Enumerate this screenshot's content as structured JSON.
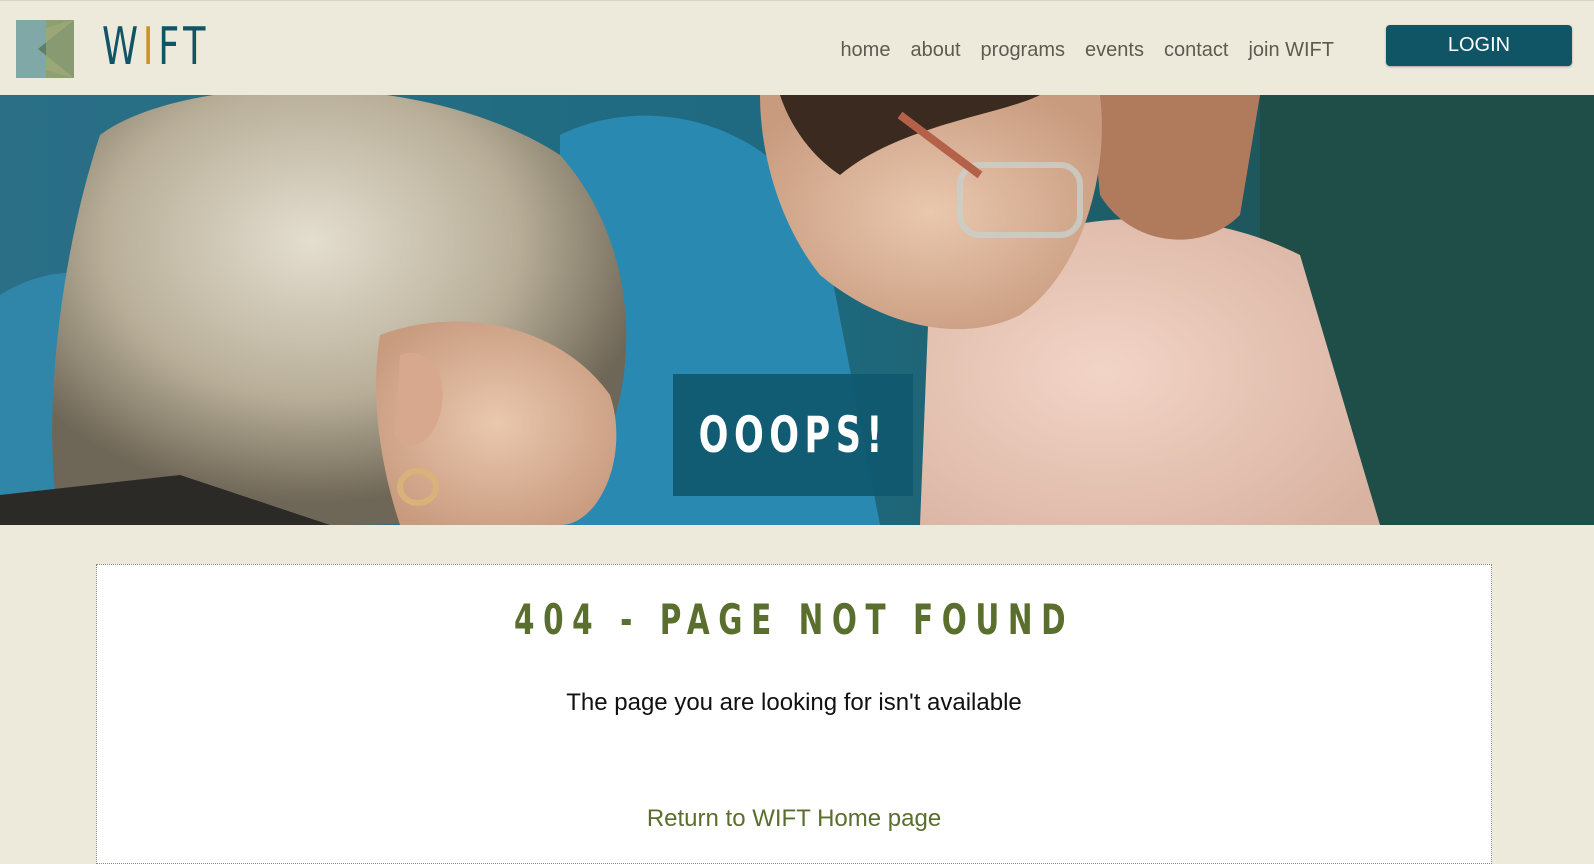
{
  "brand": {
    "logo_text_1": "W",
    "logo_text_accent": "I",
    "logo_text_2": "FT",
    "colors": {
      "teal": "#0f5566",
      "gold": "#c9951e",
      "olive": "#5a6f2e",
      "background": "#eeeadb"
    }
  },
  "nav": {
    "items": [
      {
        "label": "home"
      },
      {
        "label": "about"
      },
      {
        "label": "programs"
      },
      {
        "label": "events"
      },
      {
        "label": "contact"
      },
      {
        "label": "join WIFT"
      }
    ],
    "login_label": "LOGIN"
  },
  "hero": {
    "heading": "OOOPS!"
  },
  "error": {
    "title": "404 - PAGE NOT FOUND",
    "message": "The page you are looking for isn't available",
    "return_link": "Return to WIFT Home page"
  }
}
